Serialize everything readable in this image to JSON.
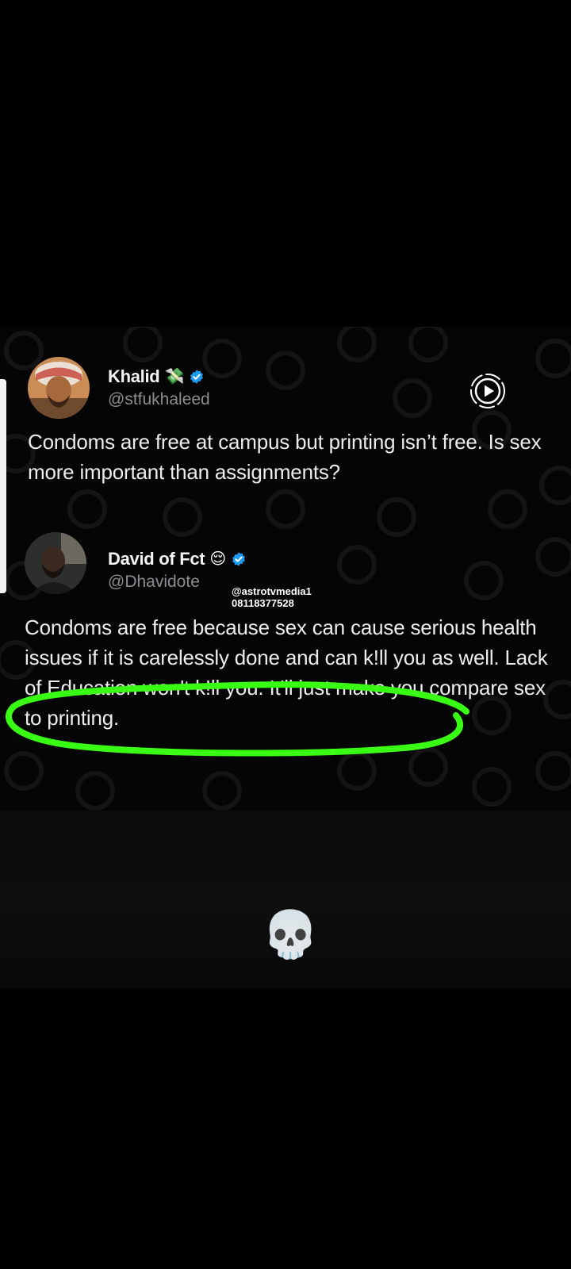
{
  "tweets": [
    {
      "display_name": "Khalid",
      "name_emoji": "💸",
      "handle": "@stfukhaleed",
      "verified": true,
      "text": "Condoms are free at campus but printing isn’t free. Is sex more important than assignments?"
    },
    {
      "display_name": "David of Fct",
      "name_emoji": "😌",
      "handle": "@Dhavidote",
      "verified": true,
      "text": "Condoms are free because sex can cause serious health issues if it is carelessly done and can k!ll you as well. Lack of Education won't k!ll you. It'll just make you compare sex to printing."
    }
  ],
  "watermark": {
    "line1": "@astrotvmedia1",
    "line2": "08118377528"
  },
  "icons": {
    "play_button": "play-circle-icon",
    "verified": "verified-badge-icon",
    "reaction": "💀"
  },
  "colors": {
    "background": "#000000",
    "verified_blue": "#1d9bf0",
    "highlight_green": "#39ff14",
    "handle_gray": "#8a8d91"
  }
}
